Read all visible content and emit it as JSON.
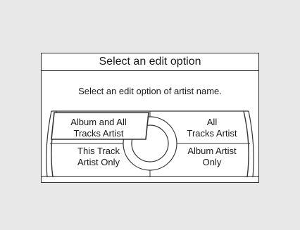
{
  "dialog": {
    "title": "Select an edit option",
    "prompt": "Select an edit option of artist name."
  },
  "options": [
    {
      "line1": "Album and All",
      "line2": "Tracks Artist",
      "selected": true
    },
    {
      "line1": "All",
      "line2": "Tracks Artist",
      "selected": false
    },
    {
      "line1": "This Track",
      "line2": "Artist Only",
      "selected": false
    },
    {
      "line1": "Album Artist",
      "line2": "Only",
      "selected": false
    }
  ]
}
